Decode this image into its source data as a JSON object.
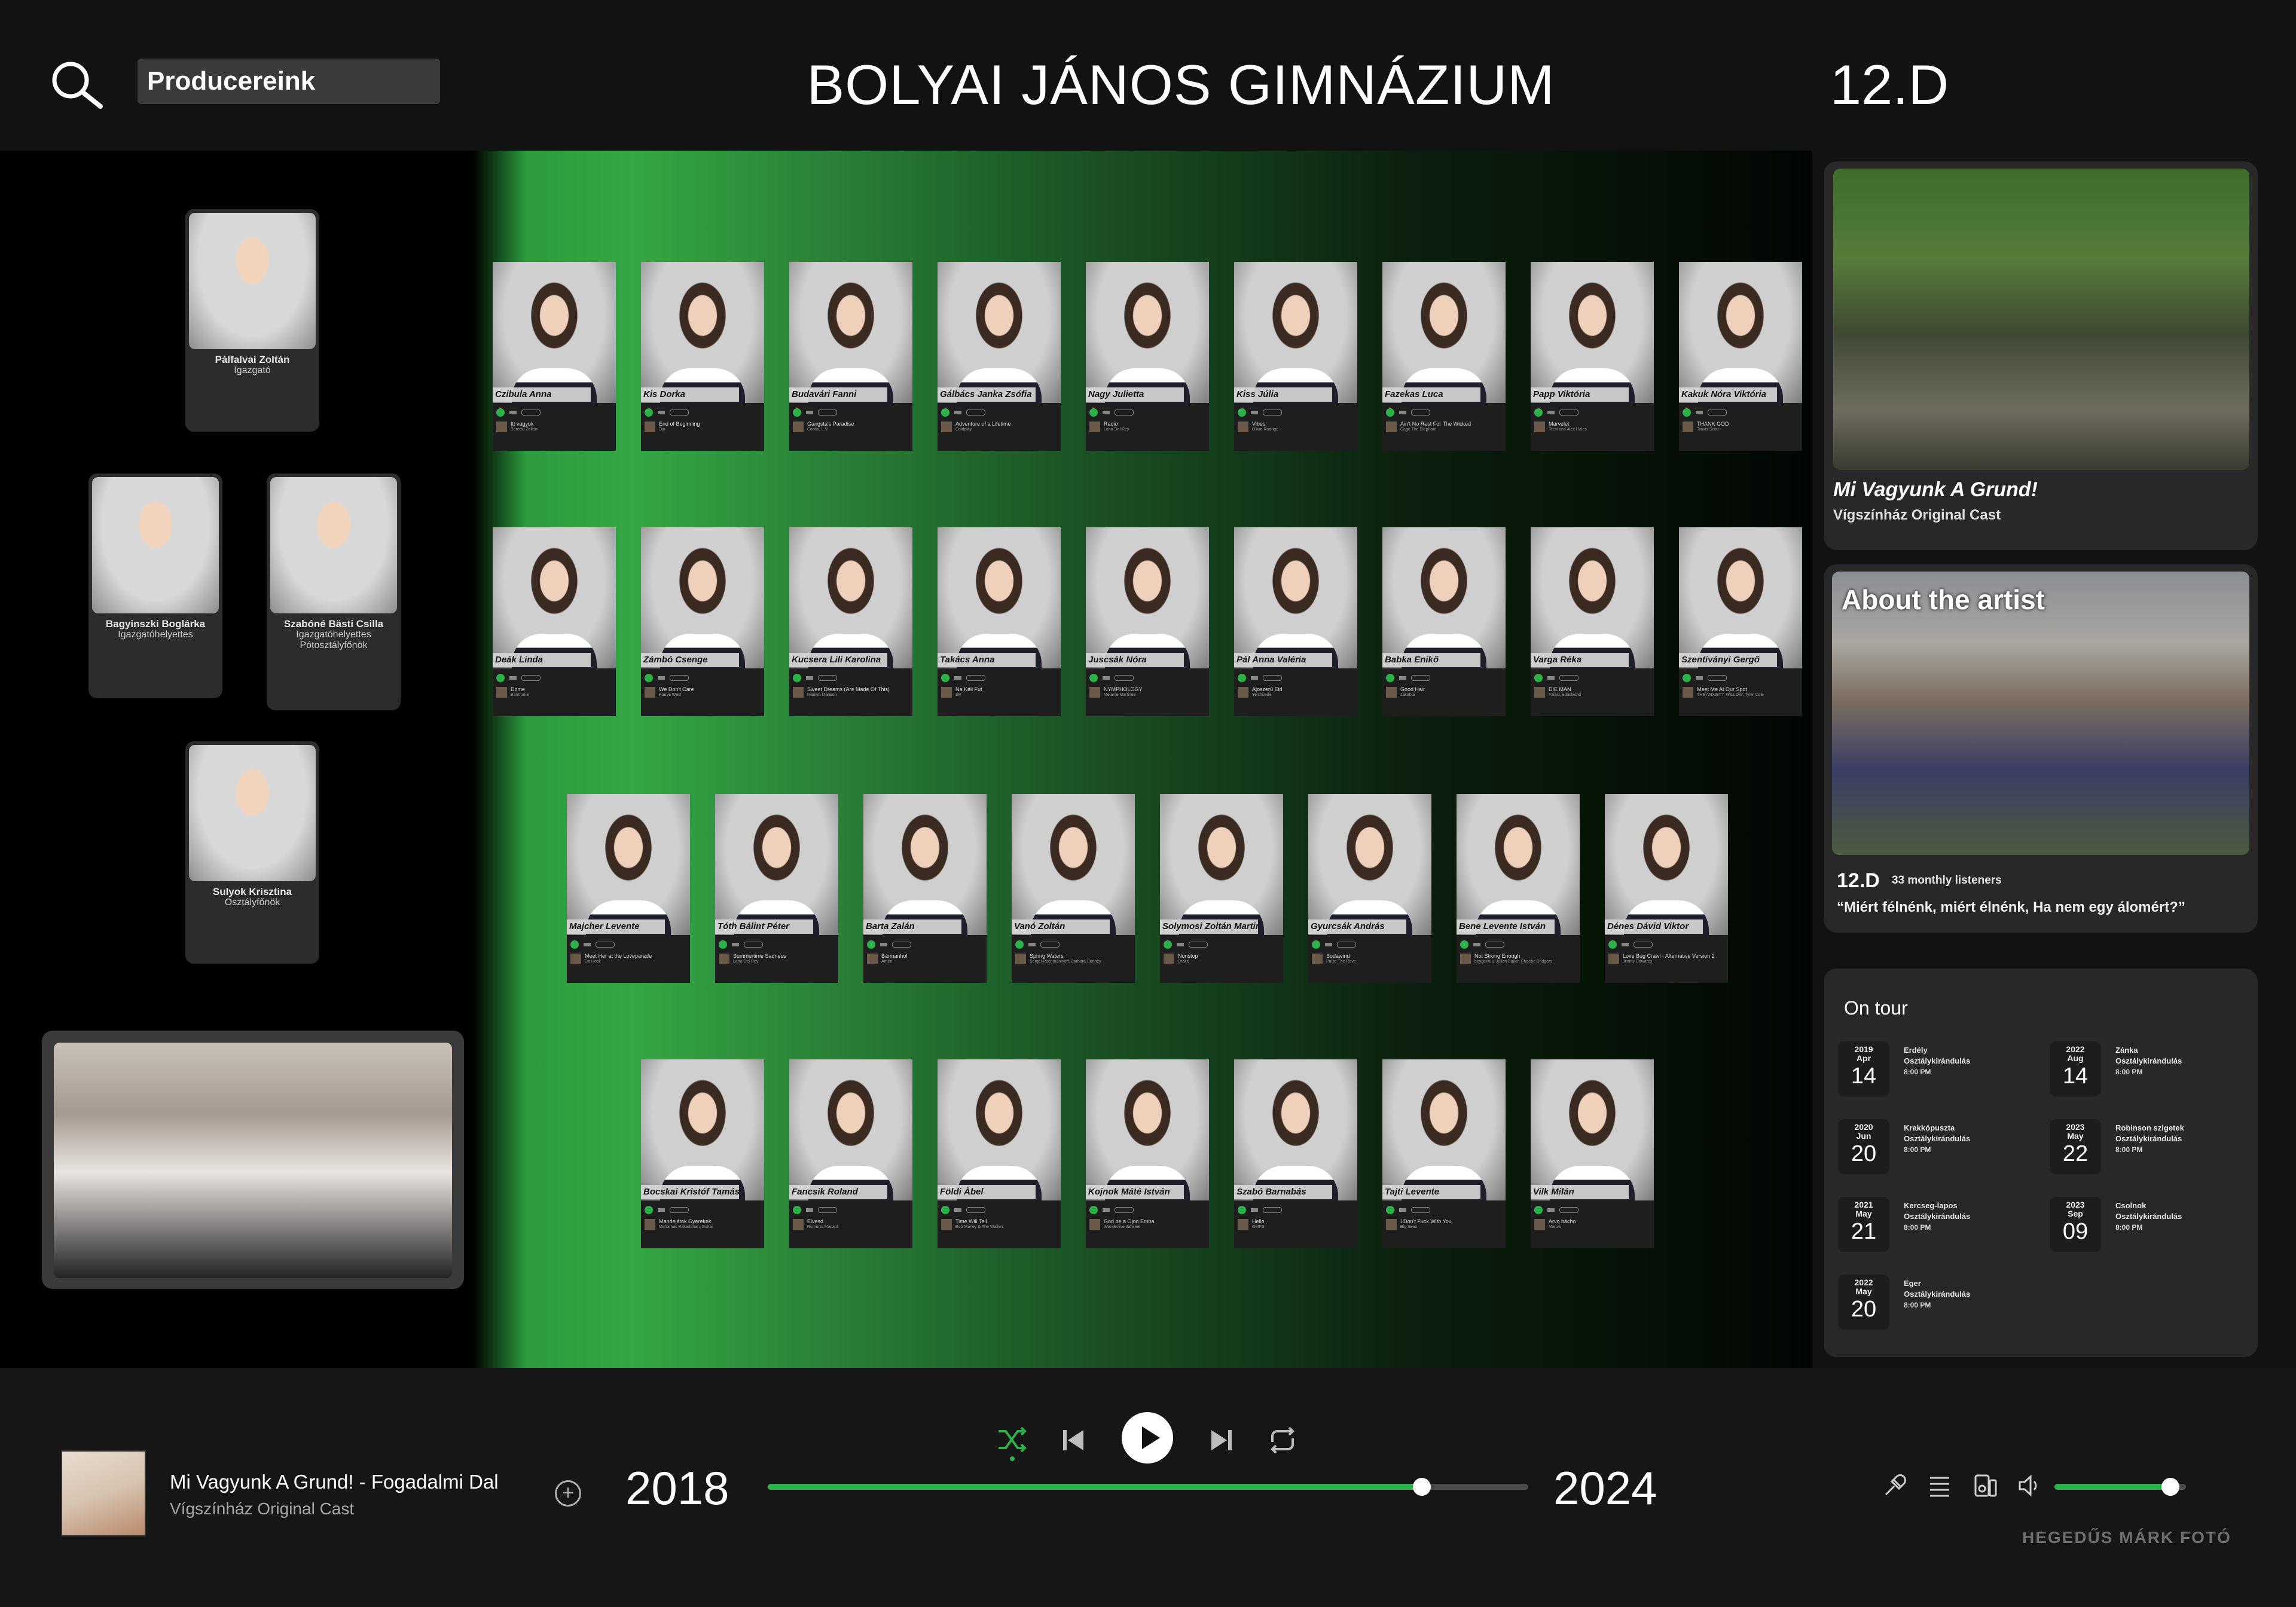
{
  "header": {
    "search_label": "Producereink",
    "school_title": "BOLYAI JÁNOS GIMNÁZIUM",
    "class_title": "12.D"
  },
  "staff": [
    {
      "name": "Pálfalvai Zoltán",
      "role": "Igazgató"
    },
    {
      "name": "Bagyinszki Boglárka",
      "role": "Igazgatóhelyettes"
    },
    {
      "name": "Szabóné Bästi Csilla",
      "role": "Igazgatóhelyettes",
      "role2": "Pótosztályfőnök"
    },
    {
      "name": "Sulyok Krisztina",
      "role": "Osztályfőnök"
    }
  ],
  "students": [
    {
      "name": "Czibula Anna",
      "song": "Itt vagyok",
      "artist": "Berecki Zoltán"
    },
    {
      "name": "Kis Dorka",
      "song": "End of Beginning",
      "artist": "Djo"
    },
    {
      "name": "Budavári Fanni",
      "song": "Gangsta's Paradise",
      "artist": "Coolio, L.V."
    },
    {
      "name": "Gálbács Janka Zsófia",
      "song": "Adventure of a Lifetime",
      "artist": "Coldplay"
    },
    {
      "name": "Nagy Julietta",
      "song": "Radio",
      "artist": "Lana Del Rey"
    },
    {
      "name": "Kiss Júlia",
      "song": "Vibes",
      "artist": "Olivia Rodrigo"
    },
    {
      "name": "Fazekas Luca",
      "song": "Ain't No Rest For The Wicked",
      "artist": "Cage The Elephant"
    },
    {
      "name": "Papp Viktória",
      "song": "Marvelet",
      "artist": "Ricsi and Alex Hales"
    },
    {
      "name": "Kakuk Nóra Viktória",
      "song": "THANK GOD",
      "artist": "Travis Scott"
    },
    {
      "name": "Deák Linda",
      "song": "Dome",
      "artist": "Bantrume"
    },
    {
      "name": "Zámbó Csenge",
      "song": "We Don't Care",
      "artist": "Kanye West"
    },
    {
      "name": "Kucsera Lili Karolina",
      "song": "Sweet Dreams (Are Made Of This)",
      "artist": "Marilyn Manson"
    },
    {
      "name": "Takács Anna",
      "song": "Na Kéli Fut",
      "artist": "SP"
    },
    {
      "name": "Juscsák Nóra",
      "song": "NYMPHOLOGY",
      "artist": "Melanie Martinez"
    },
    {
      "name": "Pál Anna Valéria",
      "song": "Ajoszerű Eid",
      "artist": "Yelchuede"
    },
    {
      "name": "Babka Enikő",
      "song": "Good Hair",
      "artist": "Jakabia"
    },
    {
      "name": "Varga Réka",
      "song": "DIE MAN",
      "artist": "Falaxi, eduskkind"
    },
    {
      "name": "Szentiványi Gergő",
      "song": "Meet Me At Our Spot",
      "artist": "THE ANXIETY, WILLOW, Tyler Cole"
    },
    {
      "name": "Majcher Levente",
      "song": "Meet Her at the Loveparade",
      "artist": "Da Hool"
    },
    {
      "name": "Tóth Bálint Péter",
      "song": "Summertime Sadness",
      "artist": "Lana Del Rey"
    },
    {
      "name": "Barta Zalán",
      "song": "Bármanhol",
      "artist": "Amén"
    },
    {
      "name": "Vanó Zoltán",
      "song": "Spring Waters",
      "artist": "Sergei Rachmaninoff, Barbara Bonney"
    },
    {
      "name": "Solymosi Zoltán Martin",
      "song": "Nonstop",
      "artist": "Drake"
    },
    {
      "name": "Gyurcsák András",
      "song": "Sodawind",
      "artist": "Pulse The Rave"
    },
    {
      "name": "Bene Levente István",
      "song": "Not Strong Enough",
      "artist": "boygenius, Julien Baker, Phoebe Bridgers"
    },
    {
      "name": "Dénes Dávid Viktor",
      "song": "Love Bug Crawl - Alternative Version 2",
      "artist": "Jimmy Edwards"
    },
    {
      "name": "Bocskai Kristóf Tamás",
      "song": "Mandejátok Gyerekek",
      "artist": "Mahamas Bakaddnan, Dukai"
    },
    {
      "name": "Fancsik Roland",
      "song": "Elvesd",
      "artist": "Rumurtu Macaol"
    },
    {
      "name": "Földi Ábel",
      "song": "Time Will Tell",
      "artist": "Bob Marley & The Wailers"
    },
    {
      "name": "Kojnok Máté István",
      "song": "God be a Ojoo Emba",
      "artist": "Wonderlive Jahseel"
    },
    {
      "name": "Szabó Barnabás",
      "song": "Hello",
      "artist": "OMFG"
    },
    {
      "name": "Tajti Levente",
      "song": "I Don't Fuck With You",
      "artist": "Big Sean"
    },
    {
      "name": "Vilk Milán",
      "song": "Arvo bácho",
      "artist": "Maruw"
    }
  ],
  "cards": {
    "playlist_title": "Mi Vagyunk A Grund!",
    "playlist_sub": "Vígszínház Original Cast",
    "about_label": "About the artist",
    "class_label": "12.D",
    "listeners": "33 monthly listeners",
    "quote": "“Miért félnénk, miért élnénk, Ha nem egy álomért?”"
  },
  "tour": {
    "title": "On tour",
    "items": [
      {
        "year": "2019",
        "month": "Apr",
        "day": "14",
        "place": "Erdély",
        "type": "Osztálykirándulás",
        "time": "8:00 PM"
      },
      {
        "year": "2022",
        "month": "Aug",
        "day": "14",
        "place": "Zánka",
        "type": "Osztálykirándulás",
        "time": "8:00 PM"
      },
      {
        "year": "2020",
        "month": "Jun",
        "day": "20",
        "place": "Krakkópuszta",
        "type": "Osztálykirándulás",
        "time": "8:00 PM"
      },
      {
        "year": "2023",
        "month": "May",
        "day": "22",
        "place": "Robinson szigetek",
        "type": "Osztálykirándulás",
        "time": "8:00 PM"
      },
      {
        "year": "2021",
        "month": "May",
        "day": "21",
        "place": "Kercseg-lapos",
        "type": "Osztálykirándulás",
        "time": "8:00 PM"
      },
      {
        "year": "2023",
        "month": "Sep",
        "day": "09",
        "place": "Csolnok",
        "type": "Osztálykirándulás",
        "time": "8:00 PM"
      },
      {
        "year": "2022",
        "month": "May",
        "day": "20",
        "place": "Eger",
        "type": "Osztálykirándulás",
        "time": "8:00 PM"
      }
    ]
  },
  "player": {
    "song_title": "Mi Vagyunk A Grund! - Fogadalmi Dal",
    "song_artist": "Vígszínház Original Cast",
    "year_start": "2018",
    "year_end": "2024",
    "progress": 0.86,
    "volume": 0.88,
    "accent": "#2fb14a"
  },
  "footer": {
    "credit": "HEGEDŰS MÁRK FOTÓ"
  },
  "icons": [
    "search-icon",
    "shuffle-icon",
    "previous-icon",
    "play-icon",
    "next-icon",
    "repeat-icon",
    "add-icon",
    "mic-icon",
    "queue-icon",
    "device-icon",
    "volume-icon"
  ]
}
